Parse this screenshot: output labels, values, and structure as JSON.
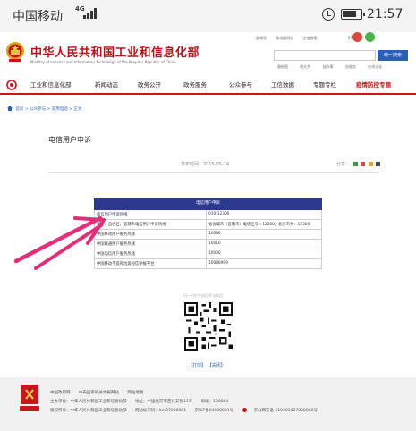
{
  "statusbar": {
    "carrier": "中国移动",
    "network": "4G",
    "time": "21:57"
  },
  "header": {
    "site_name_cn": "中华人民共和国工业和信息化部",
    "site_name_en": "Ministry of Industry and Information Technology of the People's Republic of China",
    "top_links": [
      "部领导",
      "移动版网站",
      "工信微报",
      "RSS订阅"
    ],
    "search_button": "统一搜索",
    "hot_words": [
      "最新图",
      "政文件",
      "部办事",
      "咨服务",
      "在线访谈"
    ]
  },
  "nav": {
    "items": [
      "工业和信息化部",
      "新闻动态",
      "政务公开",
      "政务服务",
      "公众参与",
      "工信数据",
      "专题专栏",
      "疫情防控专题"
    ]
  },
  "breadcrumb": [
    "首页",
    "公众参与",
    "常用电话",
    "正文"
  ],
  "article": {
    "title": "电信用户申诉",
    "publish_date": "发布时间：2015-05-14",
    "share_label": "分享："
  },
  "table": {
    "header": "电信用户申诉",
    "rows": [
      {
        "name": "电信用户申诉热线",
        "value": "010-12300"
      },
      {
        "name": "各省、自治区、直辖市电信用户申诉热线",
        "value": "省会城市（直辖市）电话区号＋12300，北京市为：12300"
      },
      {
        "name": "中国移动用户服务热线",
        "value": "10086"
      },
      {
        "name": "中国联通用户服务热线",
        "value": "10010"
      },
      {
        "name": "中国电信用户服务热线",
        "value": "10000"
      },
      {
        "name": "中国移动不良和垃圾短信举报平台",
        "value": "10086999"
      }
    ]
  },
  "qr_caption": "扫一扫在手机打开当前页",
  "page_actions": {
    "print": "【打印】",
    "close": "【关闭】"
  },
  "footer": {
    "links": [
      "中国政府网",
      "中央国家机关举报网站",
      "网站地图"
    ],
    "host": [
      "主办单位：中华人民共和国工业和信息化部",
      "地址：中国北京市西长安街13号",
      "邮编：100804"
    ],
    "copyright": [
      "版权所有：中华人民共和国工业和信息化部",
      "网站标识码：bm07000001",
      "京ICP备04000001号"
    ],
    "police": "京公网安备 110401027000068号"
  },
  "colors": {
    "brand_red": "#c8161e",
    "table_header": "#2b3a8f",
    "link_blue": "#2b5fb7",
    "arrow": "#e0307a"
  }
}
